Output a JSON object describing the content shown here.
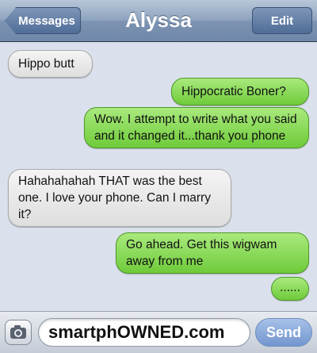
{
  "header": {
    "back_label": "Messages",
    "title": "Alyssa",
    "edit_label": "Edit"
  },
  "messages": [
    {
      "from": "them",
      "text": "Hippo butt"
    },
    {
      "from": "me",
      "text": "Hippocratic Boner?"
    },
    {
      "from": "me",
      "text": "Wow. I attempt to write what you said and it changed it...thank you phone"
    },
    {
      "from": "them",
      "text": "Hahahahahah THAT was the best one. I love your phone. Can I marry it?"
    },
    {
      "from": "me",
      "text": "Go ahead. Get this wigwam away from me"
    },
    {
      "from": "me",
      "text": "......"
    }
  ],
  "composer": {
    "input_value": "smartphOWNED.com",
    "send_label": "Send",
    "camera_icon": "camera-icon"
  },
  "colors": {
    "outgoing_bubble": "#7fd44a",
    "incoming_bubble": "#e9e9e9",
    "navbar": "#8fa4c0",
    "chat_background": "#dbe1ec"
  }
}
